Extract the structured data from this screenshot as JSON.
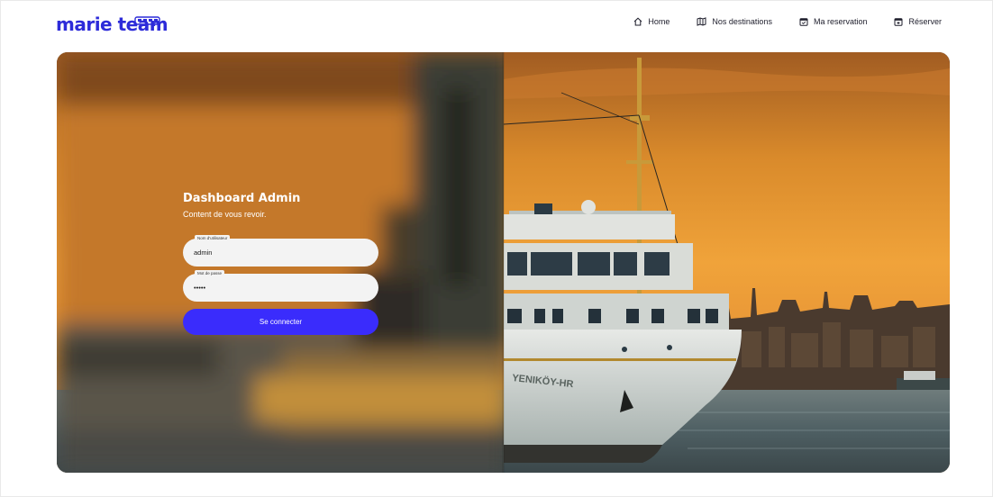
{
  "brand": {
    "name": "marie team",
    "color": "#2d2bd9"
  },
  "nav": {
    "items": [
      {
        "label": "Home",
        "icon": "home-icon"
      },
      {
        "label": "Nos destinations",
        "icon": "map-icon"
      },
      {
        "label": "Ma reservation",
        "icon": "calendar-check-icon"
      },
      {
        "label": "Réserver",
        "icon": "calendar-plus-icon"
      }
    ]
  },
  "login": {
    "title": "Dashboard Admin",
    "subtitle": "Content de vous revoir.",
    "username_label": "Nom d'utilisateur",
    "username_value": "admin",
    "password_label": "Mot de passe",
    "password_value": "admin",
    "submit_label": "Se connecter",
    "accent_color": "#3a2cfc"
  },
  "hero": {
    "ship_hull_text": "YENIKÖY-HR"
  }
}
